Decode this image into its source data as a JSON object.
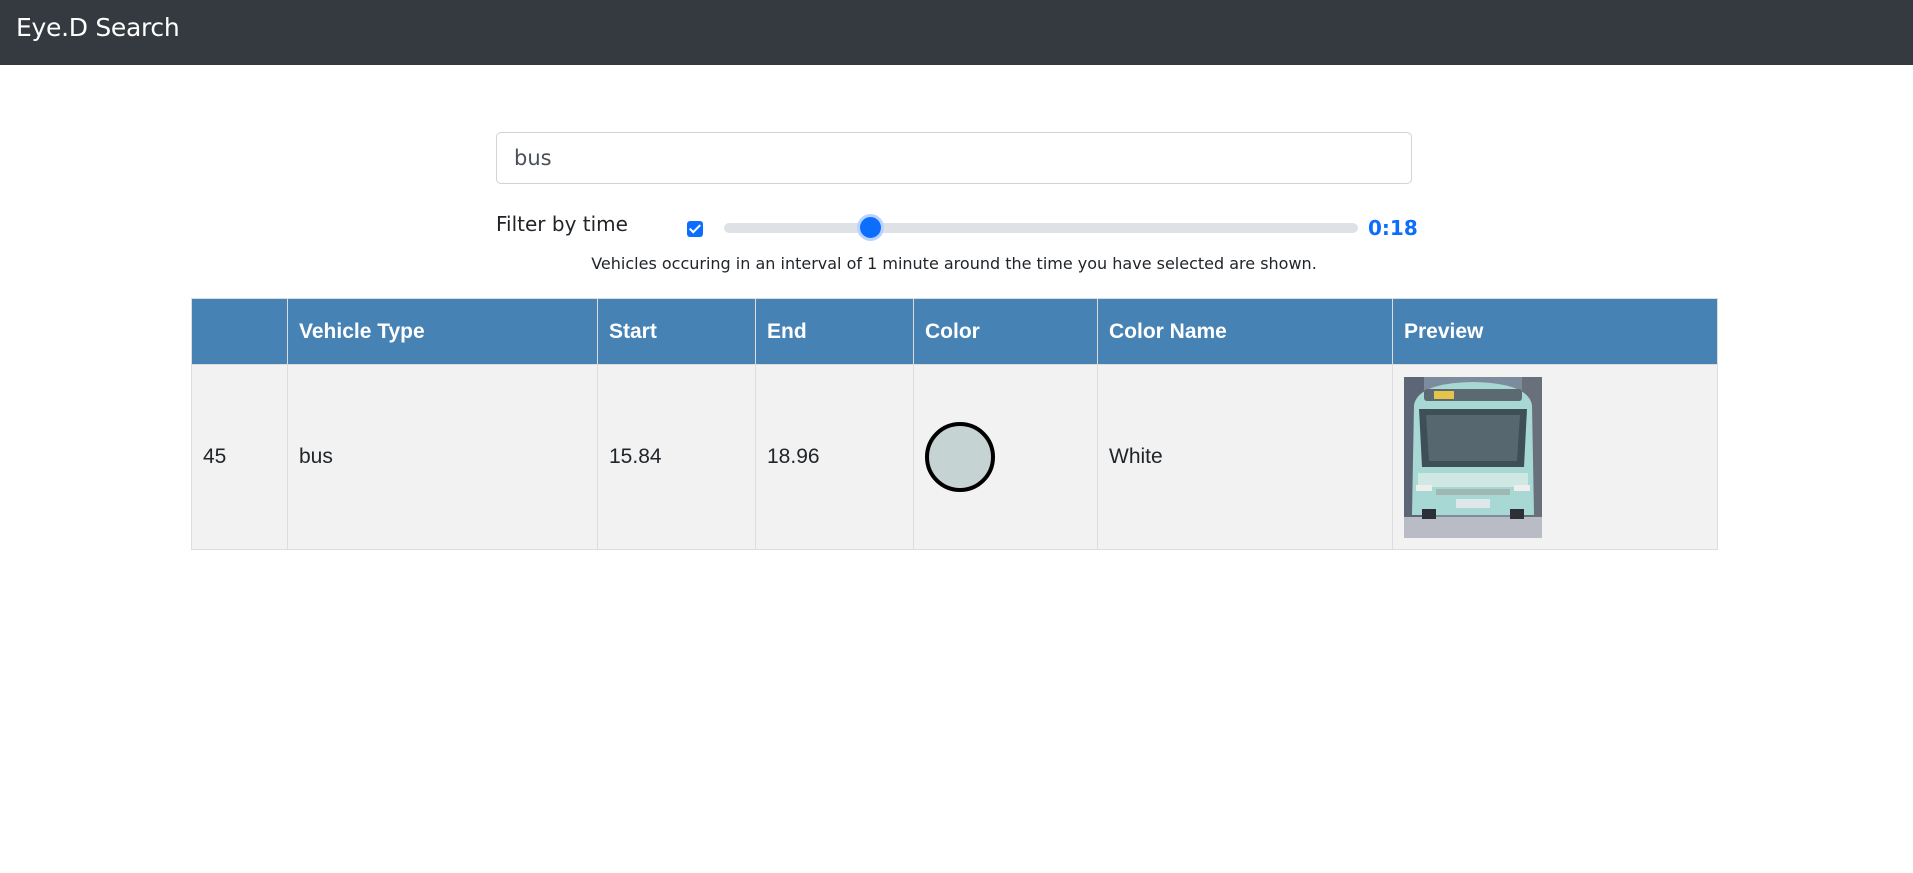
{
  "navbar": {
    "brand": "Eye.D Search"
  },
  "search": {
    "value": "bus"
  },
  "filter": {
    "label": "Filter by time",
    "enabled": true,
    "slider_fraction": 0.23,
    "time_display": "0:18",
    "help_text": "Vehicles occuring in an interval of 1 minute around the time you have selected are shown."
  },
  "table": {
    "headers": [
      "",
      "Vehicle Type",
      "Start",
      "End",
      "Color",
      "Color Name",
      "Preview"
    ],
    "rows": [
      {
        "id": "45",
        "vehicle_type": "bus",
        "start": "15.84",
        "end": "18.96",
        "color": "#c5d3d3",
        "color_name": "White",
        "preview_icon": "bus-image"
      }
    ]
  },
  "colors": {
    "navbar": "#343a40",
    "header": "#4682b4",
    "accent": "#0d6efd",
    "row": "#f2f2f2"
  }
}
